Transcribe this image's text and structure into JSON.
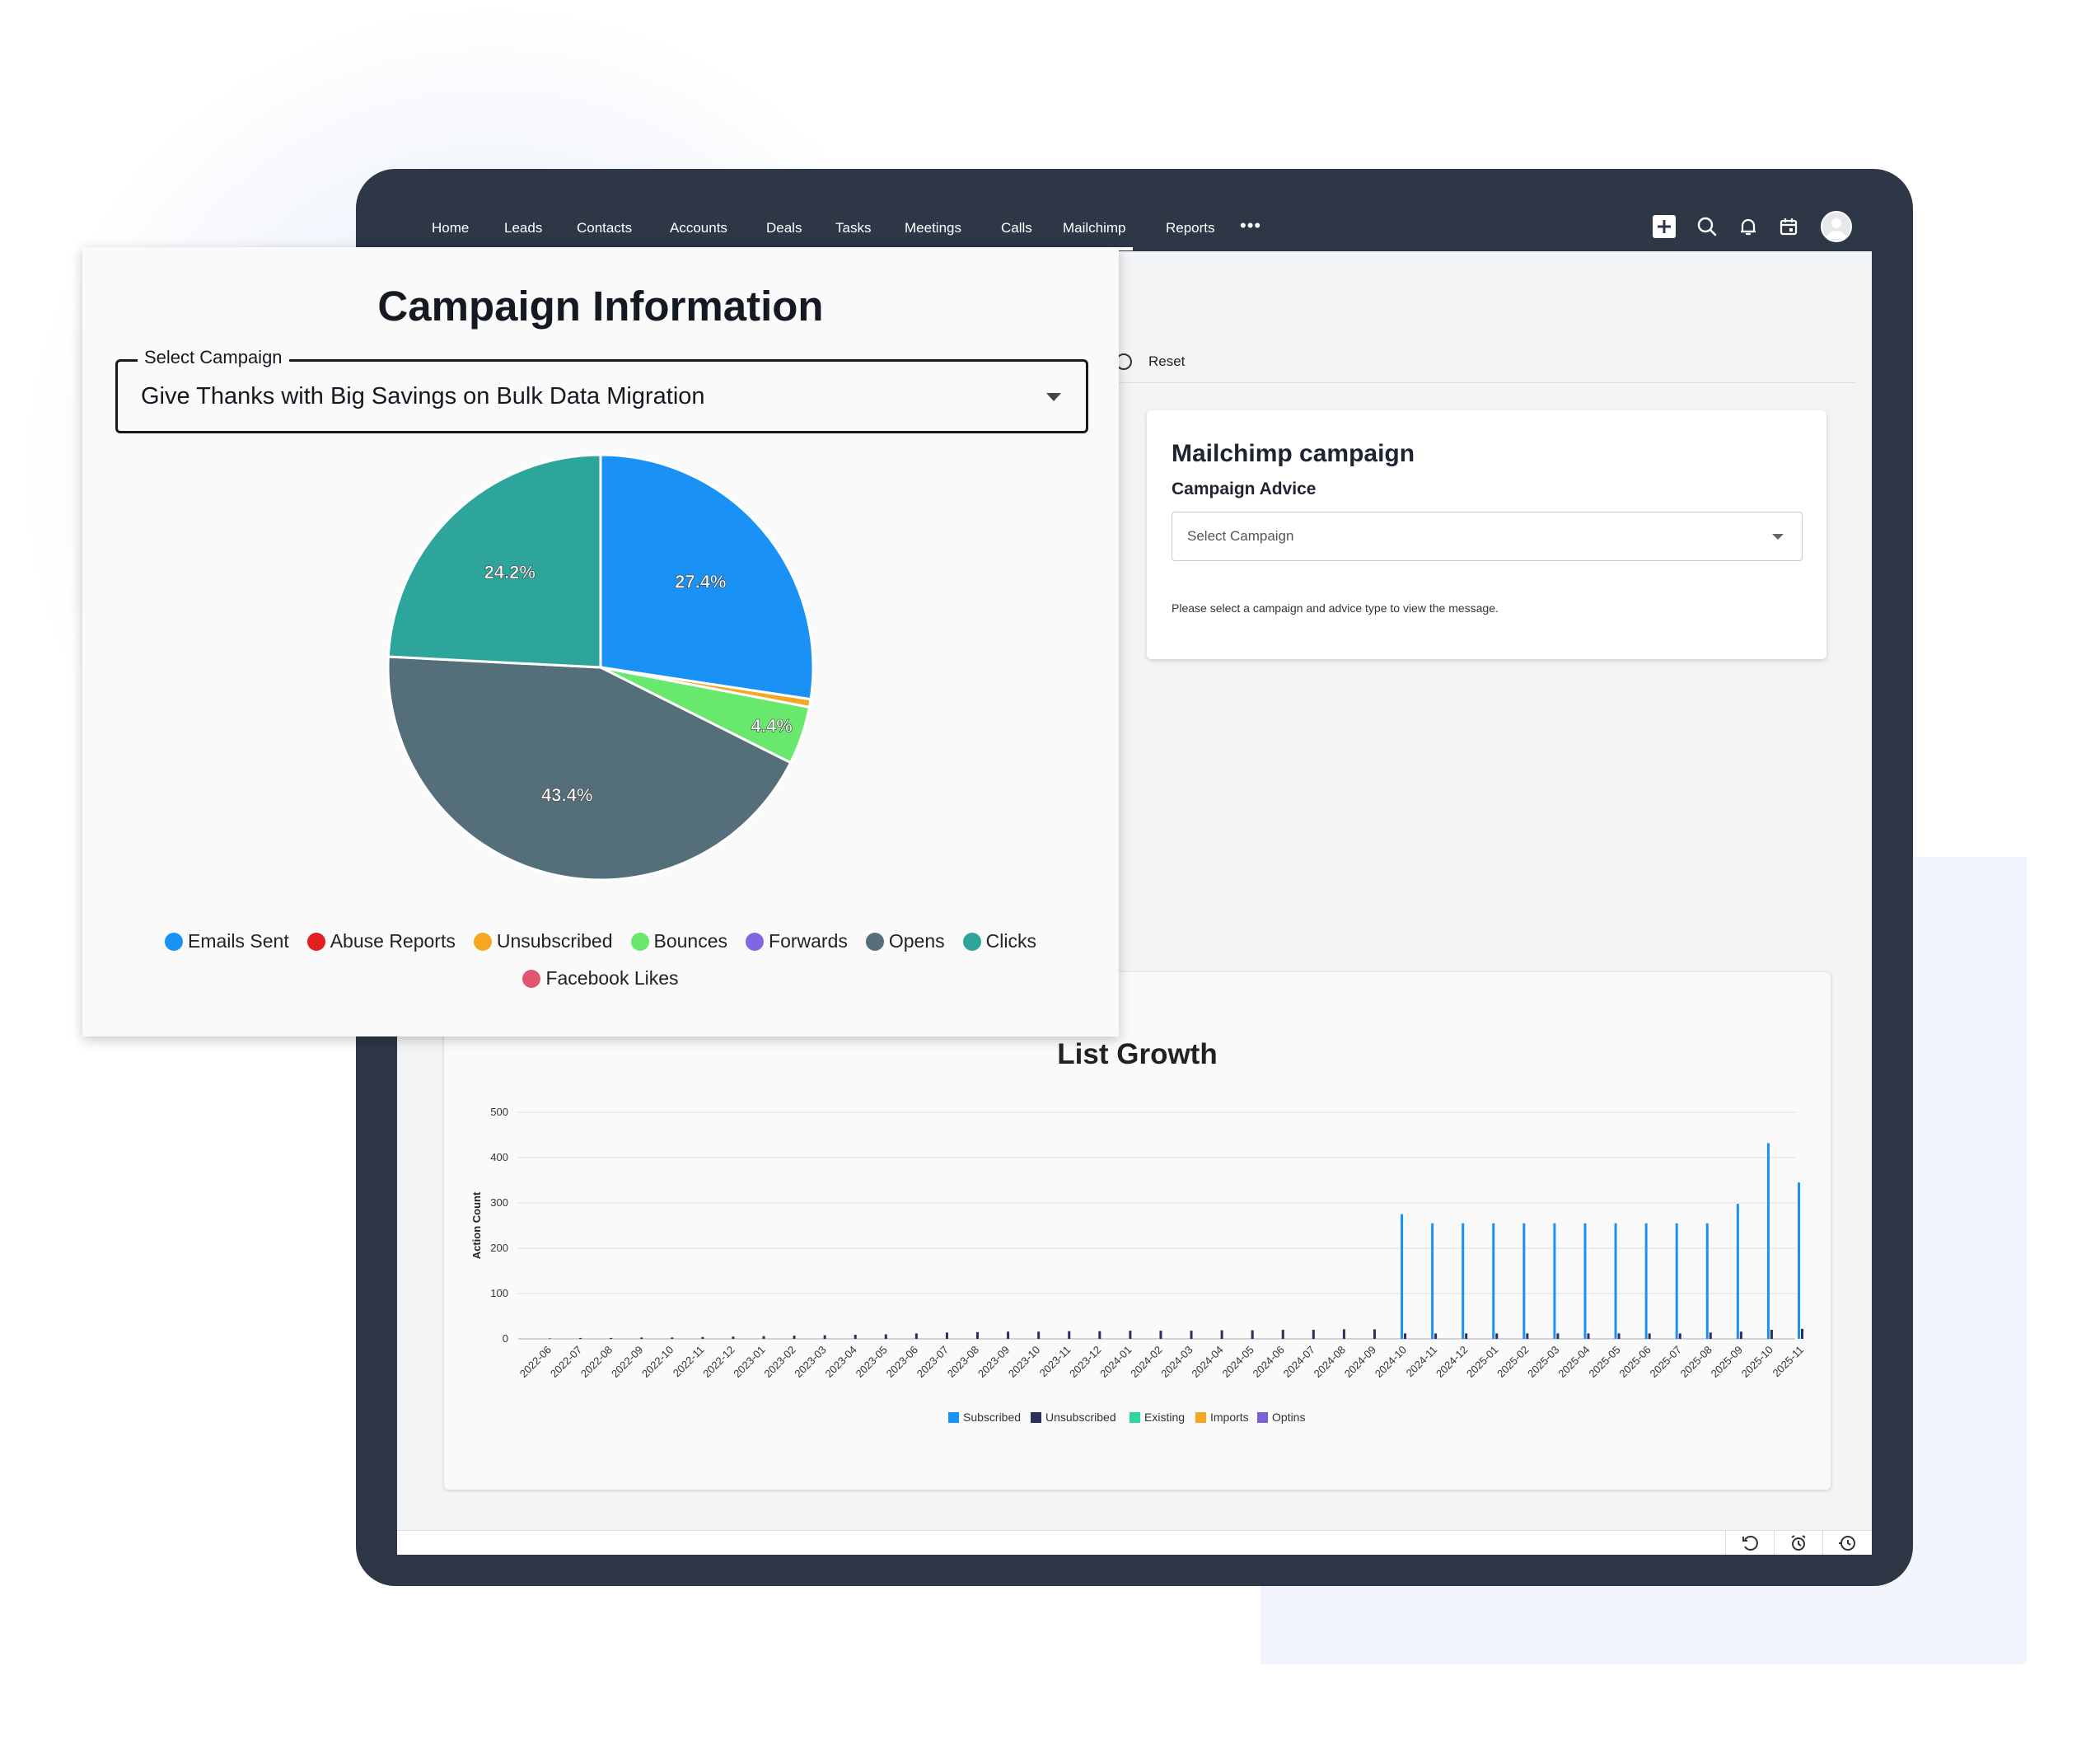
{
  "nav": {
    "items": [
      "Home",
      "Leads",
      "Contacts",
      "Accounts",
      "Deals",
      "Tasks",
      "Meetings",
      "Calls",
      "Mailchimp",
      "Reports"
    ],
    "active": "Mailchimp",
    "more": "•••",
    "icons": [
      "add-icon",
      "search-icon",
      "bell-icon",
      "calendar-icon",
      "avatar"
    ]
  },
  "toolbar": {
    "reset_label": "Reset"
  },
  "advice": {
    "title": "Mailchimp campaign",
    "subtitle": "Campaign Advice",
    "select_placeholder": "Select Campaign",
    "message": "Please select a campaign and advice type to view the message."
  },
  "campaign_info": {
    "title": "Campaign Information",
    "select_label": "Select Campaign",
    "select_value": "Give Thanks with Big Savings on Bulk Data Migration"
  },
  "colors": {
    "emails_sent": "#1a91f5",
    "abuse_reports": "#e02020",
    "unsubscribed": "#f5a623",
    "bounces": "#68e86c",
    "forwards": "#8066e0",
    "opens": "#546e7a",
    "clicks": "#2ea59b",
    "facebook_likes": "#e0566f",
    "subscribed": "#1a91f5",
    "list_unsubscribed": "#2a2f5e",
    "existing": "#2dd99a",
    "imports": "#f5a623",
    "optins": "#7b61d8"
  },
  "chart_data": [
    {
      "type": "pie",
      "title": "",
      "labels": [
        "Emails Sent",
        "Abuse Reports",
        "Unsubscribed",
        "Bounces",
        "Forwards",
        "Opens",
        "Clicks",
        "Facebook Likes"
      ],
      "values": [
        27.4,
        0,
        0.6,
        4.4,
        0,
        43.4,
        24.2,
        0
      ],
      "data_labels": [
        "27.4%",
        "",
        "",
        "4.4%",
        "",
        "43.4%",
        "24.2%",
        ""
      ],
      "legend": "bottom"
    },
    {
      "type": "bar",
      "title": "List Growth",
      "xlabel": "",
      "ylabel": "Action Count",
      "ylim": [
        0,
        500
      ],
      "yticks": [
        0,
        100,
        200,
        300,
        400,
        500
      ],
      "categories": [
        "2022-06",
        "2022-07",
        "2022-08",
        "2022-09",
        "2022-10",
        "2022-11",
        "2022-12",
        "2023-01",
        "2023-02",
        "2023-03",
        "2023-04",
        "2023-05",
        "2023-06",
        "2023-07",
        "2023-08",
        "2023-09",
        "2023-10",
        "2023-11",
        "2023-12",
        "2024-01",
        "2024-02",
        "2024-03",
        "2024-04",
        "2024-05",
        "2024-06",
        "2024-07",
        "2024-08",
        "2024-09",
        "2024-10",
        "2024-11",
        "2024-12",
        "2025-01",
        "2025-02",
        "2025-03",
        "2025-04",
        "2025-05",
        "2025-06",
        "2025-07",
        "2025-08",
        "2025-09",
        "2025-10",
        "2025-11"
      ],
      "series": [
        {
          "name": "Subscribed",
          "values": [
            0,
            0,
            0,
            0,
            0,
            0,
            0,
            0,
            0,
            0,
            0,
            0,
            0,
            0,
            0,
            0,
            0,
            0,
            0,
            0,
            0,
            0,
            0,
            0,
            0,
            0,
            0,
            0,
            275,
            255,
            255,
            255,
            255,
            255,
            255,
            255,
            255,
            255,
            255,
            298,
            432,
            345
          ]
        },
        {
          "name": "Unsubscribed",
          "values": [
            1,
            2,
            2,
            3,
            3,
            4,
            5,
            6,
            7,
            8,
            9,
            10,
            12,
            14,
            15,
            16,
            16,
            17,
            17,
            18,
            18,
            18,
            19,
            19,
            20,
            20,
            21,
            21,
            12,
            12,
            12,
            12,
            12,
            12,
            12,
            12,
            12,
            12,
            14,
            16,
            20,
            22
          ]
        },
        {
          "name": "Existing",
          "values": [
            0,
            0,
            0,
            0,
            0,
            0,
            0,
            0,
            0,
            0,
            0,
            0,
            0,
            0,
            0,
            0,
            0,
            0,
            0,
            0,
            0,
            0,
            0,
            0,
            0,
            0,
            0,
            0,
            0,
            0,
            0,
            0,
            0,
            0,
            0,
            0,
            0,
            0,
            0,
            0,
            0,
            0
          ]
        },
        {
          "name": "Imports",
          "values": [
            0,
            0,
            0,
            0,
            0,
            0,
            0,
            0,
            0,
            0,
            0,
            0,
            0,
            0,
            0,
            0,
            0,
            0,
            0,
            0,
            0,
            0,
            0,
            0,
            0,
            0,
            0,
            0,
            0,
            0,
            0,
            0,
            0,
            0,
            0,
            0,
            0,
            0,
            0,
            0,
            0,
            0
          ]
        },
        {
          "name": "Optins",
          "values": [
            0,
            0,
            0,
            0,
            0,
            0,
            0,
            0,
            0,
            0,
            0,
            0,
            0,
            0,
            0,
            0,
            0,
            0,
            0,
            0,
            0,
            0,
            0,
            0,
            0,
            0,
            0,
            0,
            0,
            0,
            0,
            0,
            0,
            0,
            0,
            0,
            0,
            0,
            0,
            0,
            0,
            0
          ]
        }
      ],
      "legend": "bottom",
      "grid": true
    }
  ]
}
